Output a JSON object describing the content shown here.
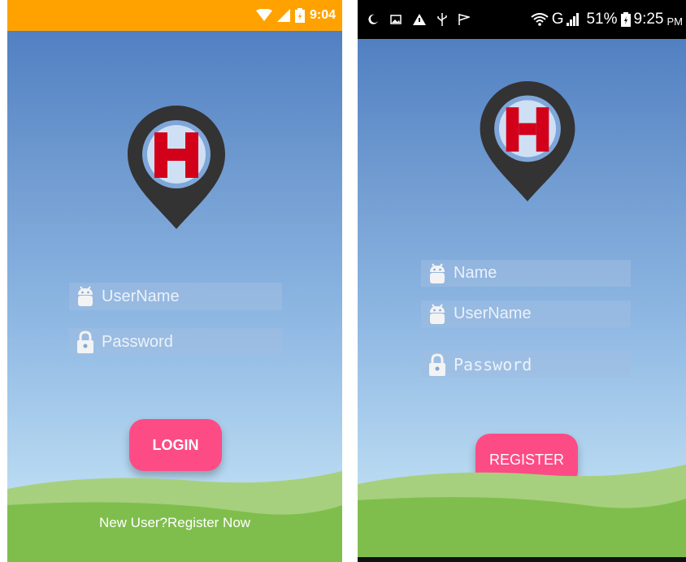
{
  "login_screen": {
    "status_time": "9:04",
    "username_placeholder": "UserName",
    "password_placeholder": "Password",
    "login_label": "LOGIN",
    "register_link": "New User?Register Now"
  },
  "register_screen": {
    "status_battery": "51%",
    "status_network": "G",
    "status_time": "9:25",
    "status_ampm": "PM",
    "name_placeholder": "Name",
    "username_placeholder": "UserName",
    "password_placeholder": "Password",
    "register_label": "REGISTER"
  },
  "colors": {
    "status_bar": "#ffa200",
    "button": "#fd4b86",
    "logo_letter": "#d3001a",
    "logo_pin": "#333333"
  },
  "icons": [
    "android-icon",
    "lock-icon",
    "map-pin-logo",
    "wifi-icon",
    "signal-icon",
    "battery-icon"
  ]
}
